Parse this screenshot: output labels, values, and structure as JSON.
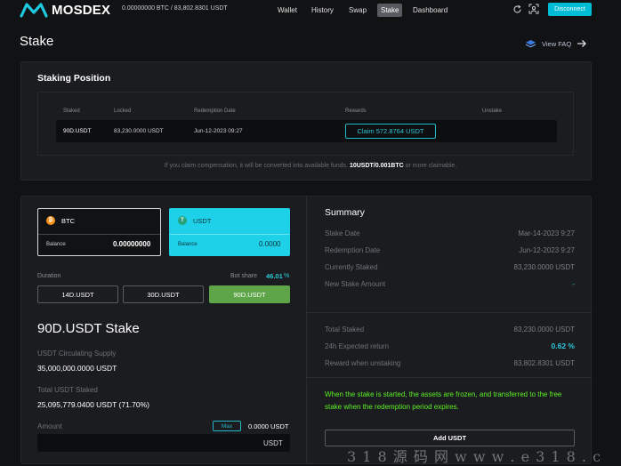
{
  "header": {
    "logo_text": "MOSDEX",
    "balance": "0.00000000 BTC / 83,802.8301 USDT",
    "nav": [
      "Wallet",
      "History",
      "Swap",
      "Stake",
      "Dashboard"
    ],
    "active_nav": "Stake",
    "disconnect_label": "Disconnect",
    "accent_color": "#00bcd4"
  },
  "page": {
    "title": "Stake",
    "view_faq": "View FAQ"
  },
  "staking_position": {
    "title": "Staking Position",
    "columns": [
      "Staked",
      "Locked",
      "Redemption Date",
      "Rewards",
      "Unstake"
    ],
    "row": {
      "staked": "90D.USDT",
      "locked": "83,230.0000 USDT",
      "redemption_date": "Jun-12-2023 09:27",
      "claim_label": "Claim 572.8764 USDT"
    },
    "note_prefix": "If you claim compensation, it will be converted into available funds.",
    "note_bold": "10USDT/0.001BTC",
    "note_suffix": "or more claimable."
  },
  "stake_form": {
    "coins": [
      {
        "name": "BTC",
        "balance_label": "Balance",
        "balance": "0.00000000",
        "icon": "bitcoin-icon",
        "color": "#f7931a"
      },
      {
        "name": "USDT",
        "balance_label": "Balance",
        "balance": "0.0000",
        "icon": "tether-icon",
        "color": "#26a17b"
      }
    ],
    "duration_label": "Duration",
    "bot_share_label": "Bot share",
    "bot_share_value": "46.01",
    "bot_share_unit": "%",
    "durations": [
      "14D.USDT",
      "30D.USDT",
      "90D.USDT"
    ],
    "selected_duration": "90D.USDT",
    "stake_title": "90D.USDT Stake",
    "circulating_label": "USDT Circulating Supply",
    "circulating_value": "35,000,000.0000 USDT",
    "total_staked_label": "Total USDT Staked",
    "total_staked_value": "25,095,779.0400 USDT (71.70%)",
    "amount_label": "Amount",
    "max_label": "Max",
    "amount_balance": "0.0000 USDT",
    "amount_unit": "USDT"
  },
  "summary": {
    "title": "Summary",
    "rows1": [
      {
        "label": "Stake Date",
        "value": "Mar-14-2023 9:27"
      },
      {
        "label": "Redemption Date",
        "value": "Jun-12-2023 9:27"
      },
      {
        "label": "Currently Staked",
        "value": "83,230.0000 USDT"
      },
      {
        "label": "New Stake Amount",
        "value": "-"
      }
    ],
    "rows2": [
      {
        "label": "Total Staked",
        "value": "83,230.0000 USDT"
      },
      {
        "label": "24h Expected return",
        "value": "0.62 %"
      },
      {
        "label": "Reward when unstaking",
        "value": "83,802.8301 USDT"
      }
    ],
    "green_note": "When the stake is started, the assets are frozen, and transferred to the free stake when the redemption period expires.",
    "add_button": "Add USDT"
  },
  "watermark": "3 1 8 源 码 网    w w w . e 3 1 8 . c"
}
